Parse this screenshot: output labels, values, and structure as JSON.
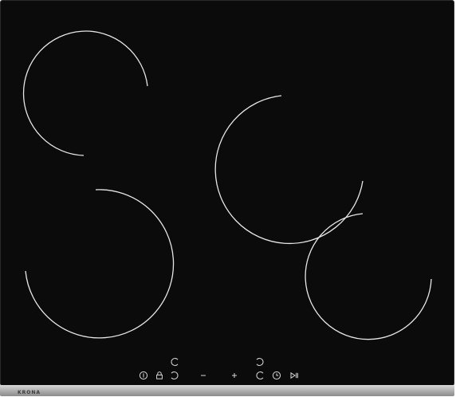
{
  "product": {
    "type": "4-zone ceramic hob",
    "glass_color": "#0b0b0b",
    "frame_color": "#a8a8a8",
    "zone_ring_color": "#e6e6e6"
  },
  "brand": {
    "logo_text": "KRONA"
  },
  "cooking_zones": [
    {
      "position": "top-left"
    },
    {
      "position": "top-right"
    },
    {
      "position": "bottom-left"
    },
    {
      "position": "bottom-right"
    }
  ],
  "control_panel": {
    "symbol_color": "#d6d6d6",
    "upper_row": [
      {
        "icon": "zone-select-icon"
      },
      {
        "icon": "zone-select-icon"
      }
    ],
    "lower_row": [
      {
        "icon": "power-icon"
      },
      {
        "icon": "lock-icon"
      },
      {
        "icon": "zone-select-icon"
      },
      {
        "icon": "minus-icon",
        "glyph": "−"
      },
      {
        "icon": "plus-icon",
        "glyph": "+"
      },
      {
        "icon": "zone-select-icon"
      },
      {
        "icon": "timer-icon"
      },
      {
        "icon": "play-pause-icon"
      }
    ]
  }
}
